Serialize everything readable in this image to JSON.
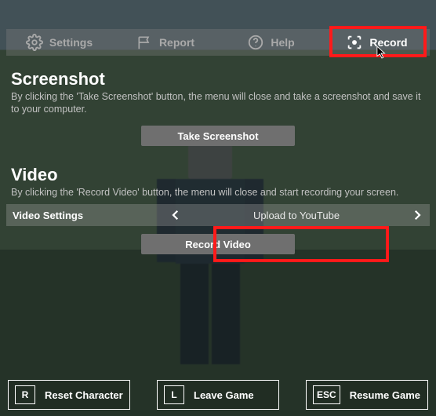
{
  "tabs": {
    "settings": "Settings",
    "report": "Report",
    "help": "Help",
    "record": "Record"
  },
  "screenshot": {
    "title": "Screenshot",
    "description": "By clicking the 'Take Screenshot' button, the menu will close and take a screenshot and save it to your computer.",
    "button": "Take Screenshot"
  },
  "video": {
    "title": "Video",
    "description": "By clicking the 'Record Video' button, the menu will close and start recording your screen.",
    "settings_label": "Video Settings",
    "selected_option": "Upload to YouTube",
    "button": "Record Video"
  },
  "bottom": {
    "reset": {
      "key": "R",
      "label": "Reset Character"
    },
    "leave": {
      "key": "L",
      "label": "Leave Game"
    },
    "resume": {
      "key": "ESC",
      "label": "Resume Game"
    }
  }
}
